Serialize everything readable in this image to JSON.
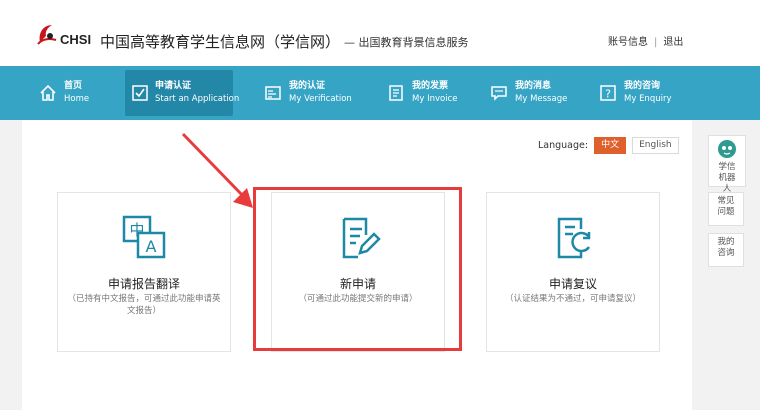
{
  "header": {
    "logo_text": "CHSI",
    "site_title": "中国高等教育学生信息网（学信网）",
    "site_subtitle": "— 出国教育背景信息服务",
    "account_label": "账号信息",
    "logout_label": "退出"
  },
  "nav": {
    "items": [
      {
        "cn": "首页",
        "en": "Home",
        "icon": "home-icon"
      },
      {
        "cn": "申请认证",
        "en": "Start an Application",
        "icon": "apply-icon"
      },
      {
        "cn": "我的认证",
        "en": "My Verification",
        "icon": "verification-icon"
      },
      {
        "cn": "我的发票",
        "en": "My Invoice",
        "icon": "invoice-icon"
      },
      {
        "cn": "我的消息",
        "en": "My Message",
        "icon": "message-icon"
      },
      {
        "cn": "我的咨询",
        "en": "My Enquiry",
        "icon": "enquiry-icon"
      }
    ],
    "active_index": 1
  },
  "language": {
    "label": "Language:",
    "options": [
      "中文",
      "English"
    ],
    "selected": "中文"
  },
  "cards": [
    {
      "title": "申请报告翻译",
      "desc": "（已持有中文报告，可通过此功能申请英文报告）",
      "icon": "translate-icon"
    },
    {
      "title": "新申请",
      "desc": "（可通过此功能提交新的申请）",
      "icon": "new-application-icon"
    },
    {
      "title": "申请复议",
      "desc": "（认证结果为不通过，可申请复议）",
      "icon": "reconsideration-icon"
    }
  ],
  "sidebar": {
    "robot": "学信机器人",
    "faq": "常见问题",
    "my_enquiry": "我的咨询"
  },
  "colors": {
    "nav_bg": "#36a4c5",
    "nav_active": "#2387a8",
    "icon_teal": "#1d8aa5",
    "highlight_red": "#e83b3b",
    "language_active": "#e0602d"
  }
}
